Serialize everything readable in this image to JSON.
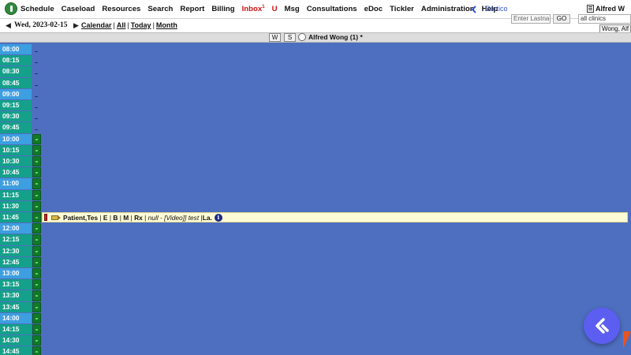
{
  "nav": {
    "items": [
      {
        "label": "Schedule",
        "color": "normal"
      },
      {
        "label": "Caseload",
        "color": "normal"
      },
      {
        "label": "Resources",
        "color": "normal"
      },
      {
        "label": "Search",
        "color": "normal"
      },
      {
        "label": "Report",
        "color": "normal"
      },
      {
        "label": "Billing",
        "color": "normal"
      },
      {
        "label": "Inbox",
        "color": "red",
        "badge": "1"
      },
      {
        "label": "U",
        "color": "red"
      },
      {
        "label": "Msg",
        "color": "normal"
      },
      {
        "label": "Consultations",
        "color": "normal"
      },
      {
        "label": "eDoc",
        "color": "normal"
      },
      {
        "label": "Tickler",
        "color": "normal"
      },
      {
        "label": "Administration",
        "color": "normal"
      },
      {
        "label": "Help",
        "color": "normal"
      }
    ],
    "cortico_label": "Cortico",
    "user_name": "Alfred W"
  },
  "datebar": {
    "prev": "◀",
    "date": "Wed, 2023-02-15",
    "next": "▶",
    "calendar": "Calendar",
    "all": "All",
    "today": "Today",
    "month": "Month",
    "search_placeholder": "Enter Lastna",
    "go_label": "GO",
    "clinic_value": "all clinics",
    "provider_value": "Wong, Alf"
  },
  "provider_header": {
    "week_label": "W",
    "search_label": "S",
    "provider_name": "Alfred Wong (1) *"
  },
  "schedule": {
    "slots": [
      {
        "time": "08:00",
        "style": "blue",
        "cell": "dash"
      },
      {
        "time": "08:15",
        "style": "teal",
        "cell": "dash"
      },
      {
        "time": "08:30",
        "style": "teal",
        "cell": "dash"
      },
      {
        "time": "08:45",
        "style": "teal",
        "cell": "dash"
      },
      {
        "time": "09:00",
        "style": "blue",
        "cell": "dash"
      },
      {
        "time": "09:15",
        "style": "teal",
        "cell": "dash"
      },
      {
        "time": "09:30",
        "style": "teal",
        "cell": "dash"
      },
      {
        "time": "09:45",
        "style": "teal",
        "cell": "dash"
      },
      {
        "time": "10:00",
        "style": "blue",
        "cell": "green"
      },
      {
        "time": "10:15",
        "style": "teal",
        "cell": "green"
      },
      {
        "time": "10:30",
        "style": "teal",
        "cell": "green"
      },
      {
        "time": "10:45",
        "style": "teal",
        "cell": "green"
      },
      {
        "time": "11:00",
        "style": "blue",
        "cell": "green"
      },
      {
        "time": "11:15",
        "style": "teal",
        "cell": "green"
      },
      {
        "time": "11:30",
        "style": "teal",
        "cell": "green"
      },
      {
        "time": "11:45",
        "style": "teal",
        "cell": "green"
      },
      {
        "time": "12:00",
        "style": "blue",
        "cell": "green"
      },
      {
        "time": "12:15",
        "style": "teal",
        "cell": "green"
      },
      {
        "time": "12:30",
        "style": "teal",
        "cell": "green"
      },
      {
        "time": "12:45",
        "style": "teal",
        "cell": "green"
      },
      {
        "time": "13:00",
        "style": "blue",
        "cell": "green"
      },
      {
        "time": "13:15",
        "style": "teal",
        "cell": "green"
      },
      {
        "time": "13:30",
        "style": "teal",
        "cell": "green"
      },
      {
        "time": "13:45",
        "style": "teal",
        "cell": "green"
      },
      {
        "time": "14:00",
        "style": "blue",
        "cell": "green"
      },
      {
        "time": "14:15",
        "style": "teal",
        "cell": "green"
      },
      {
        "time": "14:30",
        "style": "teal",
        "cell": "green"
      },
      {
        "time": "14:45",
        "style": "teal",
        "cell": "green"
      }
    ],
    "appointment": {
      "slot_time": "11:45",
      "patient": "Patient,Tes",
      "e": "E",
      "b": "B",
      "m": "M",
      "rx": "Rx",
      "notes": "null - [Video]] test",
      "tail": "La.",
      "info": "i"
    }
  },
  "colors": {
    "schedule_bg": "#4e6fc0",
    "hour_slot": "#3d9ee0",
    "quarter_slot": "#14a08a",
    "bookable": "#0e7a27",
    "appointment_bg": "#fffbd6",
    "cortico_fab": "#5b5ef0"
  }
}
